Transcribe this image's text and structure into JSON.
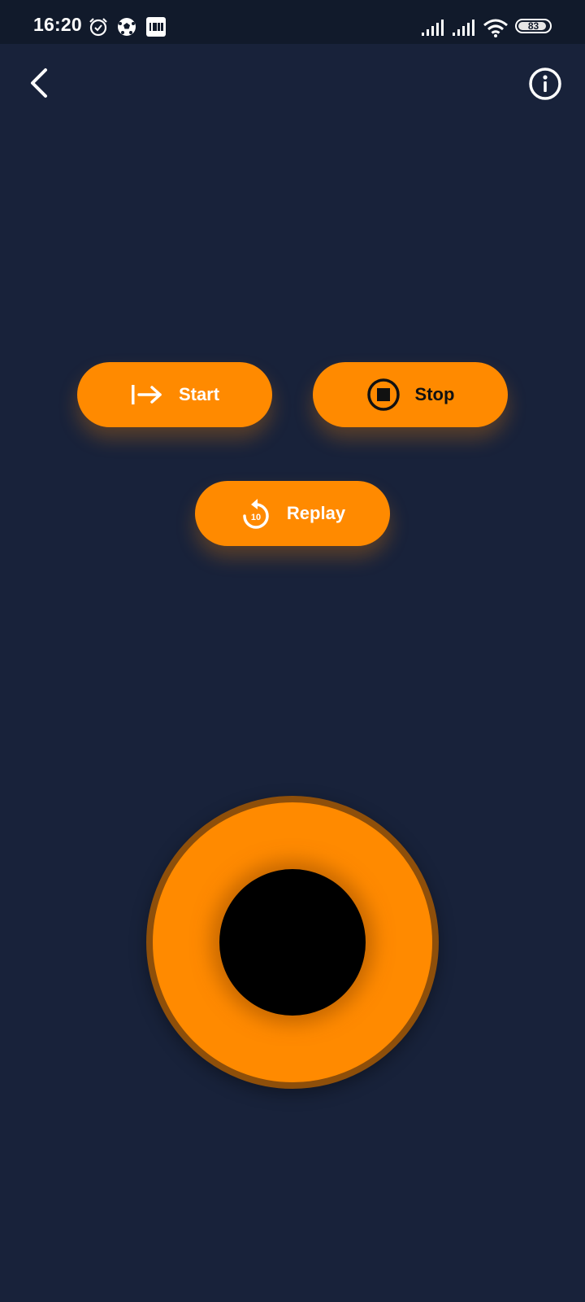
{
  "status_bar": {
    "time": "16:20",
    "battery": "83",
    "icons": [
      "alarm-icon",
      "soccer-ball-icon",
      "imdb-icon",
      "signal-icon",
      "signal-icon",
      "wifi-icon",
      "battery-icon"
    ]
  },
  "header": {
    "back_icon": "chevron-left-icon",
    "info_icon": "info-circle-icon"
  },
  "controls": {
    "start_label": "Start",
    "stop_label": "Stop",
    "replay_label": "Replay",
    "replay_seconds": "10"
  },
  "colors": {
    "background": "#18223a",
    "status_bar": "#111a2b",
    "accent": "#ff8a00",
    "ring_border": "#8e4f0a"
  }
}
